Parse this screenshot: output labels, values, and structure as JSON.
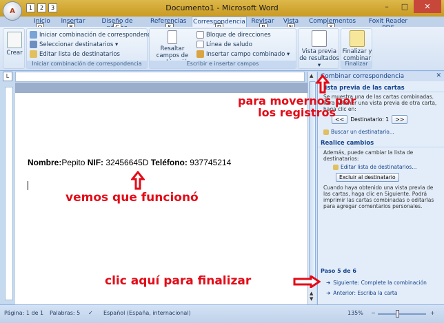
{
  "window": {
    "title": "Documento1 - Microsoft Word",
    "office_button_keytip": "A",
    "qat_keytips": [
      "1",
      "2",
      "3"
    ],
    "controls": [
      "–",
      "□",
      "✕"
    ]
  },
  "tabs": [
    {
      "label": "Inicio",
      "keytip": "O"
    },
    {
      "label": "Insertar",
      "keytip": "B"
    },
    {
      "label": "Diseño de página",
      "keytip": "C"
    },
    {
      "label": "Referencias",
      "keytip": "S"
    },
    {
      "label": "Correspondencia",
      "keytip": "D",
      "active": true
    },
    {
      "label": "Revisar",
      "keytip": "R"
    },
    {
      "label": "Vista",
      "keytip": "N"
    },
    {
      "label": "Complementos",
      "keytip": "X"
    },
    {
      "label": "Foxit Reader PDF",
      "keytip": ""
    }
  ],
  "ribbon": {
    "crear": {
      "label": "Crear"
    },
    "group_inicio": {
      "label": "Iniciar combinación de correspondencia",
      "items": [
        "Iniciar combinación de correspondencia ▾",
        "Seleccionar destinatarios ▾",
        "Editar lista de destinatarios"
      ]
    },
    "group_escribir": {
      "label": "Escribir e insertar campos",
      "big_button": "Resaltar campos de combinación",
      "items": [
        "Bloque de direcciones",
        "Línea de saludo",
        "Insertar campo combinado ▾"
      ]
    },
    "group_vista": {
      "label": "",
      "big_button": "Vista previa de resultados ▾"
    },
    "group_finalizar": {
      "label": "Finalizar",
      "big_button": "Finalizar y combinar ▾"
    }
  },
  "document": {
    "label_nombre": "Nombre:",
    "value_nombre": "Pepito ",
    "label_nif": "NIF:",
    "value_nif": " 32456645D ",
    "label_tel": "Teléfono:",
    "value_tel": " 937745214"
  },
  "taskpane": {
    "title": "Combinar correspondencia",
    "section_preview": "Vista previa de las cartas",
    "preview_text": "Se muestra una de las cartas combinadas. Para obtener una vista previa de otra carta, haga clic en:",
    "prev_btn": "<<",
    "recipient_label": "Destinatario: 1",
    "next_btn": ">>",
    "find_link": "Buscar un destinatario...",
    "section_changes": "Realice cambios",
    "changes_text": "Además, puede cambiar la lista de destinatarios:",
    "edit_link": "Editar lista de destinatarios...",
    "exclude_btn": "Excluir al destinatario",
    "info_text": "Cuando haya obtenido una vista previa de las cartas, haga clic en Siguiente. Podrá imprimir las cartas combinadas o editarlas para agregar comentarios personales.",
    "step_label": "Paso 5 de 6",
    "next_link": "Siguiente: Complete la combinación",
    "prev_link": "Anterior: Escriba la carta"
  },
  "statusbar": {
    "page": "Página: 1 de 1",
    "words": "Palabras: 5",
    "language": "Español (España, internacional)",
    "zoom": "135%"
  },
  "annotations": {
    "top": "para movernos por\nlos registros",
    "middle": "vemos que funcionó",
    "bottom": "clic aquí para finalizar"
  },
  "colors": {
    "annotation": "#e30b17",
    "accent": "#15428b"
  }
}
